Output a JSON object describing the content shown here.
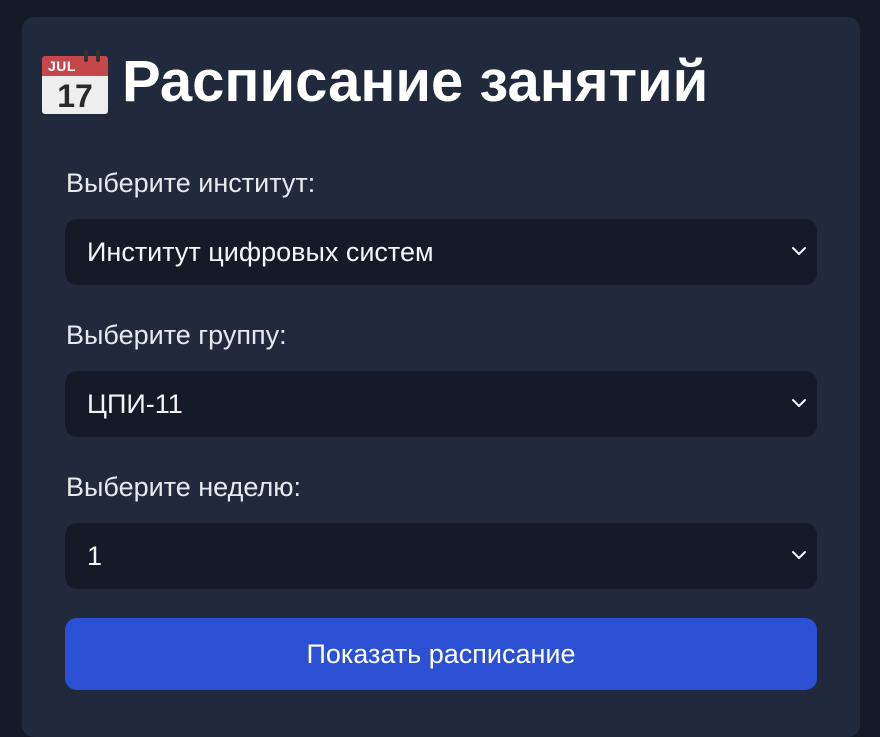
{
  "header": {
    "icon": "calendar-icon",
    "icon_month": "JUL",
    "icon_day": "17",
    "title": "Расписание занятий"
  },
  "form": {
    "institute_label": "Выберите институт:",
    "institute_value": "Институт цифровых систем",
    "group_label": "Выберите группу:",
    "group_value": "ЦПИ-11",
    "week_label": "Выберите неделю:",
    "week_value": "1",
    "submit_label": "Показать расписание"
  },
  "colors": {
    "background": "#141a28",
    "card": "#212a3c",
    "field": "#141a28",
    "accent": "#2c50d3"
  }
}
